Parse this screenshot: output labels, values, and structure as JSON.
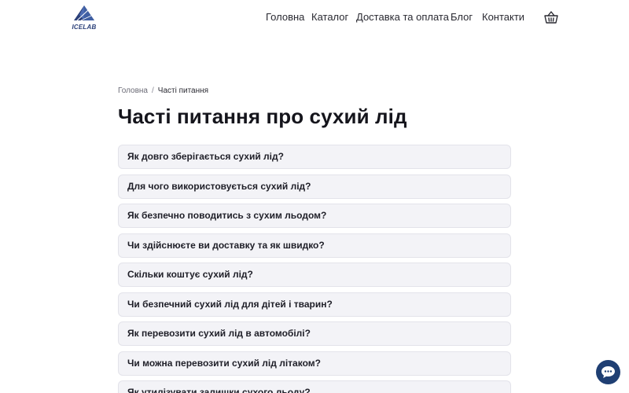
{
  "header": {
    "logo_text": "ICELAB",
    "nav": [
      {
        "label": "Головна"
      },
      {
        "label": "Каталог"
      },
      {
        "label": "Доставка та оплата"
      },
      {
        "label": "Блог"
      },
      {
        "label": "Контакти"
      }
    ],
    "cart_icon": "basket-icon"
  },
  "breadcrumb": {
    "home": "Головна",
    "separator": "/",
    "current": "Часті питання"
  },
  "page": {
    "title": "Часті питання про сухий лід"
  },
  "faq": [
    {
      "question": "Як довго зберігається сухий лід?"
    },
    {
      "question": "Для чого використовується сухий лід?"
    },
    {
      "question": "Як безпечно поводитись з сухим льодом?"
    },
    {
      "question": "Чи здійснюєте ви доставку та як швидко?"
    },
    {
      "question": "Скільки коштує сухий лід?"
    },
    {
      "question": "Чи безпечний сухий лід для дітей і тварин?"
    },
    {
      "question": "Як перевозити сухий лід в автомобілі?"
    },
    {
      "question": "Чи можна перевозити сухий лід літаком?"
    },
    {
      "question": "Як утилізувати залишки сухого льоду?"
    }
  ],
  "chat_widget": {
    "icon": "chat-bubble-icon"
  },
  "colors": {
    "brand": "#1f3f73",
    "faq_background": "#f3f3f7",
    "faq_border": "#e3e3ea",
    "text": "#1c1c24"
  }
}
